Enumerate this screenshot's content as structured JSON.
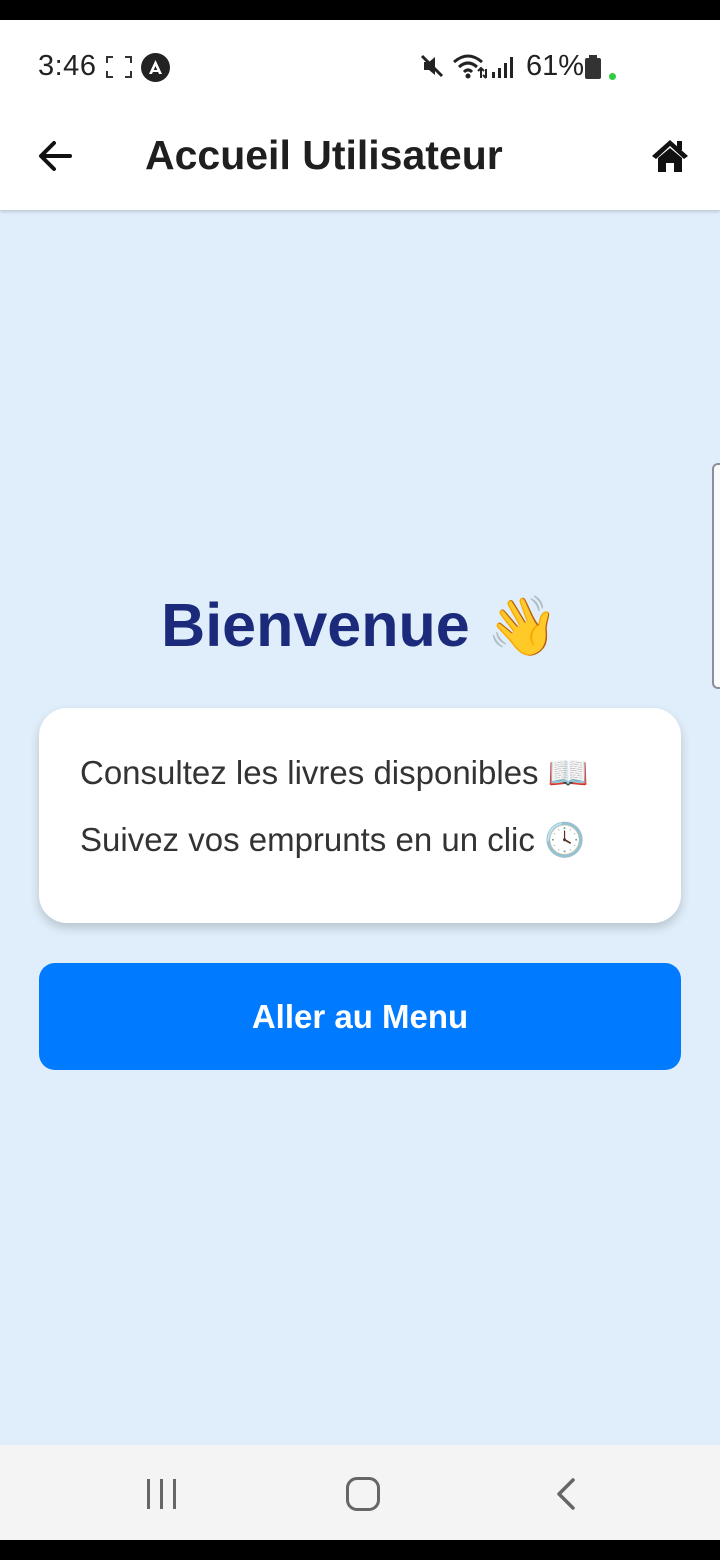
{
  "status_bar": {
    "time": "3:46",
    "battery_percent": "61%",
    "icons": [
      "screen-expand-icon",
      "app-notification-icon",
      "mute-icon",
      "wifi-icon",
      "signal-icon",
      "battery-icon"
    ]
  },
  "header": {
    "title": "Accueil Utilisateur",
    "back_icon": "arrow-left-icon",
    "home_icon": "home-icon"
  },
  "main": {
    "welcome_text": "Bienvenue",
    "welcome_emoji": "👋",
    "info_lines": [
      "Consultez les livres disponibles 📖",
      "Suivez vos emprunts en un clic 🕓"
    ],
    "menu_button_label": "Aller au Menu"
  },
  "nav_bar": {
    "icons": [
      "recent-apps-icon",
      "home-nav-icon",
      "back-nav-icon"
    ]
  },
  "colors": {
    "background": "#e0eefb",
    "accent": "#007bff",
    "title": "#1b2a7a",
    "card": "#ffffff"
  }
}
